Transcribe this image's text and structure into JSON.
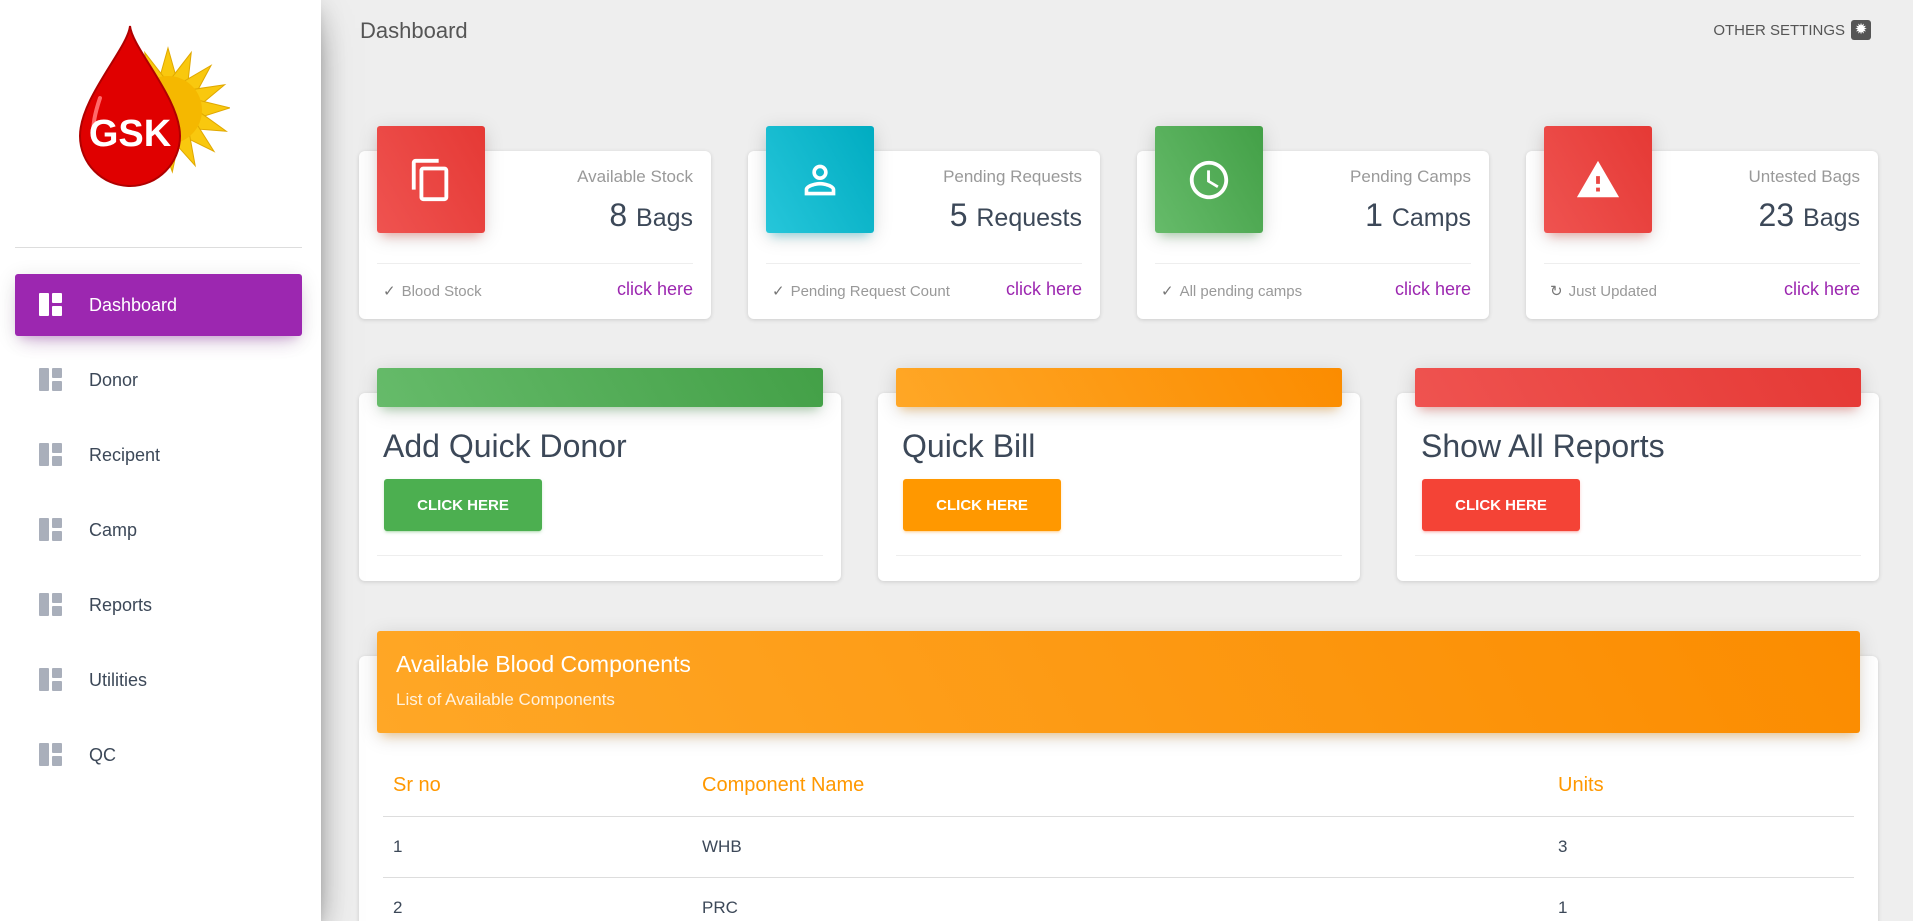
{
  "app": {
    "logo_text": "GSK"
  },
  "sidebar": {
    "items": [
      {
        "label": "Dashboard",
        "icon": "dashboard-icon",
        "active": true
      },
      {
        "label": "Donor",
        "icon": "dashboard-icon",
        "active": false
      },
      {
        "label": "Recipent",
        "icon": "dashboard-icon",
        "active": false
      },
      {
        "label": "Camp",
        "icon": "dashboard-icon",
        "active": false
      },
      {
        "label": "Reports",
        "icon": "dashboard-icon",
        "active": false
      },
      {
        "label": "Utilities",
        "icon": "dashboard-icon",
        "active": false
      },
      {
        "label": "QC",
        "icon": "dashboard-icon",
        "active": false
      }
    ]
  },
  "header": {
    "title": "Dashboard",
    "settings_label": "OTHER SETTINGS",
    "settings_icon": "gear-icon"
  },
  "stats": [
    {
      "category": "Available Stock",
      "value": "8",
      "unit": "Bags",
      "footer": "Blood Stock",
      "footer_icon": "check-icon",
      "link": "click here",
      "icon": "copy-icon",
      "color": "#ef5350"
    },
    {
      "category": "Pending Requests",
      "value": "5",
      "unit": "Requests",
      "footer": "Pending Request Count",
      "footer_icon": "check-icon",
      "link": "click here",
      "icon": "person-icon",
      "color": "#26c6da"
    },
    {
      "category": "Pending Camps",
      "value": "1",
      "unit": "Camps",
      "footer": "All pending camps",
      "footer_icon": "check-icon",
      "link": "click here",
      "icon": "clock-icon",
      "color": "#66bb6a"
    },
    {
      "category": "Untested Bags",
      "value": "23",
      "unit": "Bags",
      "footer": "Just Updated",
      "footer_icon": "refresh-icon",
      "link": "click here",
      "icon": "warning-icon",
      "color": "#ef5350"
    }
  ],
  "actions": [
    {
      "title": "Add Quick Donor",
      "button": "CLICK HERE",
      "color": "#4caf50"
    },
    {
      "title": "Quick Bill",
      "button": "CLICK HERE",
      "color": "#ff9800"
    },
    {
      "title": "Show All Reports",
      "button": "CLICK HERE",
      "color": "#f44336"
    }
  ],
  "components": {
    "title": "Available Blood Components",
    "subtitle": "List of Available Components",
    "columns": [
      "Sr no",
      "Component Name",
      "Units"
    ],
    "rows": [
      [
        "1",
        "WHB",
        "3"
      ],
      [
        "2",
        "PRC",
        "1"
      ]
    ]
  }
}
